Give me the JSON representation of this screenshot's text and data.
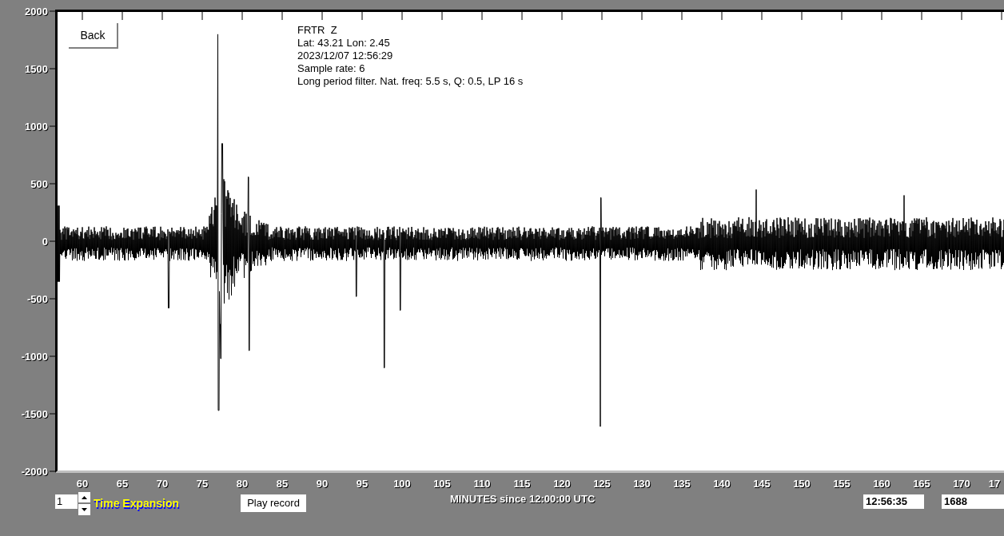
{
  "back_button": "Back",
  "info": [
    "FRTR  Z",
    "Lat: 43.21 Lon: 2.45",
    "2023/12/07 12:56:29",
    "Sample rate: 6",
    "Long period filter. Nat. freq: 5.5 s, Q: 0.5, LP 16 s"
  ],
  "y_axis": {
    "ticks": [
      "2000",
      "1500",
      "1000",
      "500",
      "0",
      "-500",
      "-1000",
      "-1500",
      "-2000"
    ]
  },
  "x_axis": {
    "ticks": [
      "60",
      "65",
      "70",
      "75",
      "80",
      "85",
      "90",
      "95",
      "100",
      "105",
      "110",
      "115",
      "120",
      "125",
      "130",
      "135",
      "140",
      "145",
      "150",
      "155",
      "160",
      "165",
      "170",
      "17"
    ],
    "label": "MINUTES since 12:00:00 UTC"
  },
  "time_expansion": {
    "value": "1",
    "label": "Time Expansion"
  },
  "play_button": "Play record",
  "time_field": "12:56:35",
  "count_field": "1688"
}
